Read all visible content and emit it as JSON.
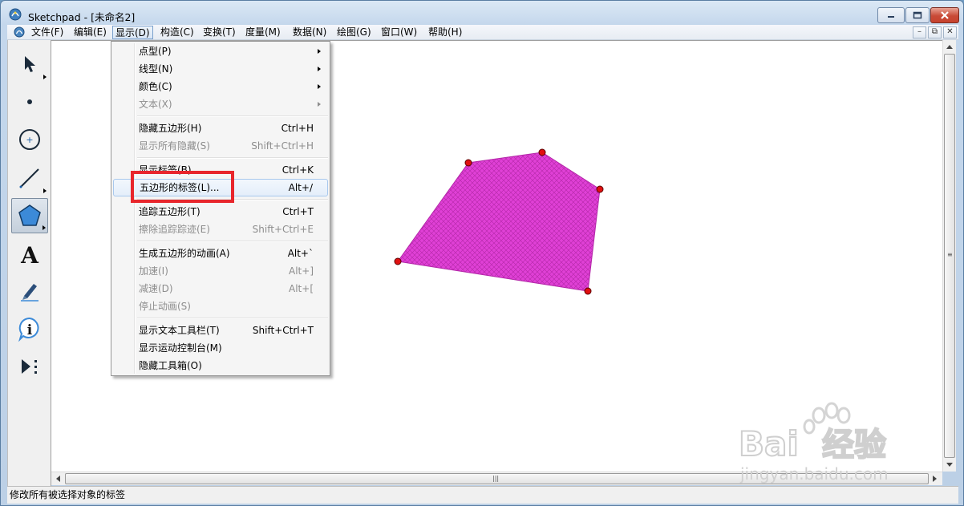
{
  "window": {
    "title": "Sketchpad  - [未命名2]",
    "minimize_symbol": "▁",
    "maximize_symbol": "□",
    "close_symbol": "✕"
  },
  "menubar": {
    "items": [
      "文件(F)",
      "编辑(E)",
      "显示(D)",
      "构造(C)",
      "变换(T)",
      "度量(M)",
      "数据(N)",
      "绘图(G)",
      "窗口(W)",
      "帮助(H)"
    ],
    "active_index": 2,
    "mdi_controls": [
      "–",
      "⧉",
      "✕"
    ]
  },
  "toolbox": {
    "tools": [
      {
        "name": "arrow-tool",
        "icon": "arrow-icon"
      },
      {
        "name": "point-tool",
        "icon": "point-icon"
      },
      {
        "name": "compass-tool",
        "icon": "circle-icon"
      },
      {
        "name": "straightedge-tool",
        "icon": "segment-icon"
      },
      {
        "name": "polygon-tool",
        "icon": "pentagon-icon",
        "selected": true
      },
      {
        "name": "text-tool",
        "icon": "text-icon",
        "glyph": "A"
      },
      {
        "name": "marker-tool",
        "icon": "marker-icon"
      },
      {
        "name": "information-tool",
        "icon": "info-icon",
        "glyph": "i"
      },
      {
        "name": "custom-tool",
        "icon": "custom-tool-icon"
      }
    ]
  },
  "dropdown": {
    "items": [
      {
        "label": "点型(P)",
        "submenu": true
      },
      {
        "label": "线型(N)",
        "submenu": true
      },
      {
        "label": "颜色(C)",
        "submenu": true
      },
      {
        "label": "文本(X)",
        "submenu": true,
        "disabled": true
      },
      {
        "separator": true
      },
      {
        "label": "隐藏五边形(H)",
        "shortcut": "Ctrl+H"
      },
      {
        "label": "显示所有隐藏(S)",
        "shortcut": "Shift+Ctrl+H",
        "disabled": true
      },
      {
        "separator": true
      },
      {
        "label": "显示标签(B)",
        "shortcut": "Ctrl+K"
      },
      {
        "label": "五边形的标签(L)...",
        "shortcut": "Alt+/",
        "highlight": true
      },
      {
        "separator": true
      },
      {
        "label": "追踪五边形(T)",
        "shortcut": "Ctrl+T"
      },
      {
        "label": "擦除追踪踪迹(E)",
        "shortcut": "Shift+Ctrl+E",
        "disabled": true
      },
      {
        "separator": true
      },
      {
        "label": "生成五边形的动画(A)",
        "shortcut": "Alt+`"
      },
      {
        "label": "加速(I)",
        "shortcut": "Alt+]",
        "disabled": true
      },
      {
        "label": "减速(D)",
        "shortcut": "Alt+[",
        "disabled": true
      },
      {
        "label": "停止动画(S)",
        "disabled": true
      },
      {
        "separator": true
      },
      {
        "label": "显示文本工具栏(T)",
        "shortcut": "Shift+Ctrl+T"
      },
      {
        "label": "显示运动控制台(M)"
      },
      {
        "label": "隐藏工具箱(O)"
      }
    ]
  },
  "canvas": {
    "polygon_fill": "#e040d6",
    "vertex_color": "#e01010"
  },
  "statusbar": {
    "text": "修改所有被选择对象的标签"
  },
  "watermark": {
    "brand_latin": "Bai",
    "brand_cn": "经验",
    "url": "jingyan.baidu.com"
  },
  "colors": {
    "accent": "#e8262c",
    "menu_highlight": "#a8c8ed"
  }
}
